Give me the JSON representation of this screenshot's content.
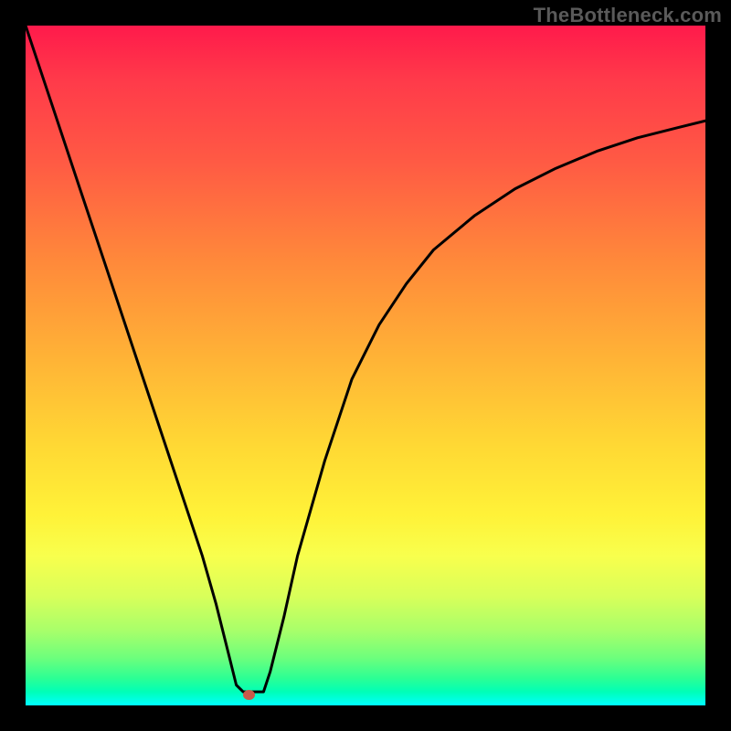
{
  "watermark": "TheBottleneck.com",
  "chart_data": {
    "type": "line",
    "title": "",
    "xlabel": "",
    "ylabel": "",
    "xlim": [
      0,
      100
    ],
    "ylim": [
      0,
      100
    ],
    "series": [
      {
        "name": "bottleneck-curve",
        "x": [
          0,
          4,
          8,
          12,
          16,
          20,
          24,
          26,
          28,
          30,
          31,
          32,
          34,
          35,
          36,
          38,
          40,
          44,
          48,
          52,
          56,
          60,
          66,
          72,
          78,
          84,
          90,
          96,
          100
        ],
        "y": [
          100,
          88,
          76,
          64,
          52,
          40,
          28,
          22,
          15,
          7,
          3,
          2,
          2,
          2,
          5,
          13,
          22,
          36,
          48,
          56,
          62,
          67,
          72,
          76,
          79,
          81.5,
          83.5,
          85,
          86
        ]
      }
    ],
    "marker": {
      "x": 32.8,
      "y": 1.6,
      "color": "#c85a4a"
    },
    "gradient_stops": [
      {
        "pos": 0.0,
        "color": "#ff1a4b"
      },
      {
        "pos": 0.5,
        "color": "#ffd934"
      },
      {
        "pos": 0.78,
        "color": "#f8ff4d"
      },
      {
        "pos": 1.0,
        "color": "#00ffff"
      }
    ]
  }
}
